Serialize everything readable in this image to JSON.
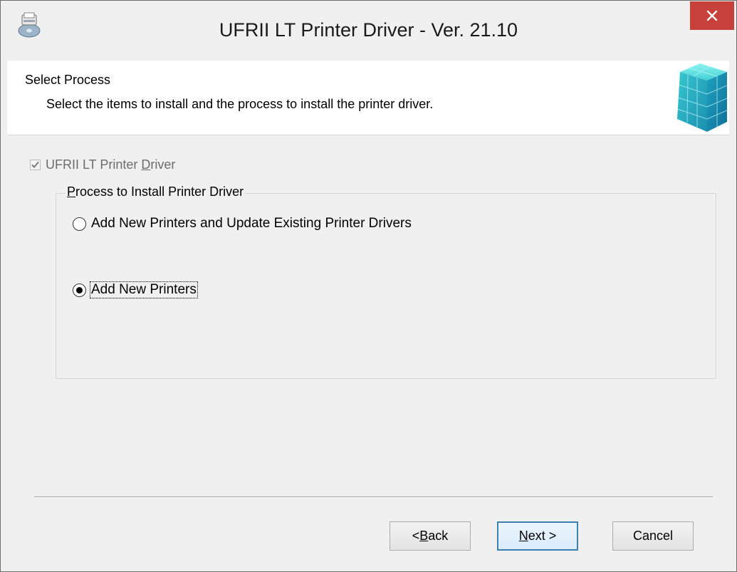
{
  "window": {
    "title": "UFRII LT Printer Driver - Ver. 21.10"
  },
  "header": {
    "title": "Select Process",
    "description": "Select the items to install and the process to install the printer driver."
  },
  "component": {
    "label_pre": "UFRII LT Printer ",
    "label_mnemonic": "D",
    "label_post": "river",
    "checked": true,
    "enabled": false
  },
  "process_group": {
    "label_mnemonic": "P",
    "label_post": "rocess to Install Printer Driver",
    "options": [
      {
        "label": "Add New Printers and Update Existing Printer Drivers",
        "selected": false
      },
      {
        "label": "Add New Printers",
        "selected": true
      }
    ]
  },
  "buttons": {
    "back": {
      "pre": "< ",
      "mnemonic": "B",
      "post": "ack"
    },
    "next": {
      "pre": "",
      "mnemonic": "N",
      "post": "ext >"
    },
    "cancel": {
      "label": "Cancel"
    }
  },
  "colors": {
    "close_button": "#c7403a",
    "default_button_border": "#3c7fb1",
    "dialog_background": "#f0f0f0"
  },
  "icons": {
    "app": "printer-disc-icon",
    "close": "close-icon",
    "header": "blocks-cube-icon"
  }
}
